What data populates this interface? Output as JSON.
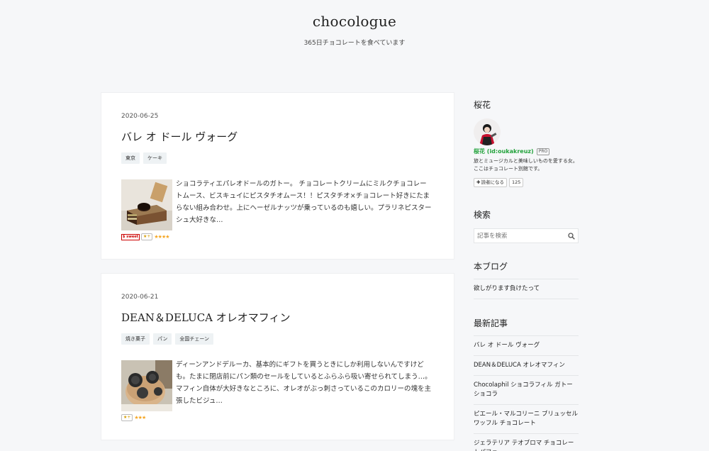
{
  "header": {
    "title": "chocologue",
    "description": "365日チョコレートを食べています"
  },
  "entries": [
    {
      "date": "2020-06-25",
      "title": "バレ オ ドール ヴォーグ",
      "tags": [
        "東京",
        "ケーキ"
      ],
      "excerpt": "ショコラティエパレオドールのガトー。 チョコレートクリームにミルクチョコレートムース、ビスキュイにピスタチオムース！！ピスタチオ×チョコレート好きにたまらない組み合わせ。上にヘーゼルナッツが乗っているのも嬉しい。プラリネピスターシュ大好きな…",
      "sale_badge": "$ sweet",
      "star_button": "★+",
      "stars": "★★★★"
    },
    {
      "date": "2020-06-21",
      "title": "DEAN＆DELUCA オレオマフィン",
      "tags": [
        "焼き菓子",
        "パン",
        "全国チェーン"
      ],
      "excerpt": "ディーンアンドデルーカ、基本的にギフトを買うときにしか利用しないんですけども。たまに閉店前にパン類のセールをしているとふらふら吸い寄せられてしまう…。 マフィン自体が大好きなところに、オレオがぶっ刺さっているこのカロリーの塊を主張したビジュ…",
      "star_button": "★+",
      "stars": "★★★"
    }
  ],
  "sidebar": {
    "profile": {
      "heading": "桜花",
      "name": "桜花 (id:oukakreuz)",
      "pro_badge": "PRO",
      "description": "旅とミュージカルと美味しいものを愛する女。ここはチョコレート別館です。",
      "follow_label": "読者になる",
      "follow_count": "125"
    },
    "search": {
      "heading": "検索",
      "placeholder": "記事を検索"
    },
    "blog": {
      "heading": "本ブログ",
      "links": [
        "欲しがります負けたって"
      ]
    },
    "recent": {
      "heading": "最新記事",
      "links": [
        "バレ オ ドール ヴォーグ",
        "DEAN＆DELUCA オレオマフィン",
        "Chocolaphil ショコラフィル ガトーショコラ",
        "ピエール・マルコリーニ ブリュッセルワッフル チョコレート",
        "ジェラテリア テオブロマ チョコレートパフェ"
      ]
    }
  },
  "colors": {
    "background": "#f6f7f9",
    "profile_name": "#22a23b",
    "star": "#f5a623",
    "tag_bg": "#eef2f4"
  }
}
